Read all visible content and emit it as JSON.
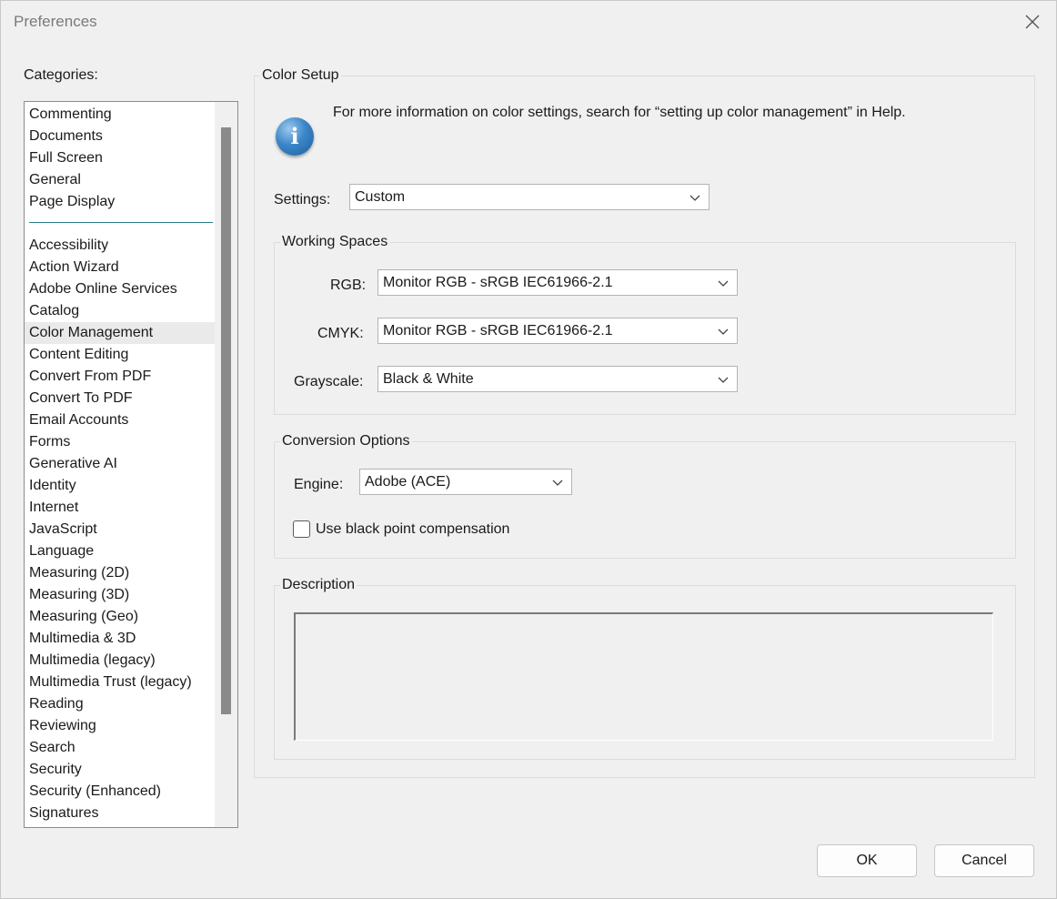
{
  "window": {
    "title": "Preferences",
    "close_icon": "close-icon"
  },
  "categories": {
    "label": "Categories:",
    "top_items": [
      "Commenting",
      "Documents",
      "Full Screen",
      "General",
      "Page Display"
    ],
    "items": [
      "Accessibility",
      "Action Wizard",
      "Adobe Online Services",
      "Catalog",
      "Color Management",
      "Content Editing",
      "Convert From PDF",
      "Convert To PDF",
      "Email Accounts",
      "Forms",
      "Generative AI",
      "Identity",
      "Internet",
      "JavaScript",
      "Language",
      "Measuring (2D)",
      "Measuring (3D)",
      "Measuring (Geo)",
      "Multimedia & 3D",
      "Multimedia (legacy)",
      "Multimedia Trust (legacy)",
      "Reading",
      "Reviewing",
      "Search",
      "Security",
      "Security (Enhanced)",
      "Signatures"
    ],
    "selected": "Color Management"
  },
  "color_setup": {
    "title": "Color Setup",
    "info_text": "For more information on color settings, search for “setting up color management” in Help.",
    "settings_label": "Settings:",
    "settings_value": "Custom"
  },
  "working_spaces": {
    "title": "Working Spaces",
    "rgb_label": "RGB:",
    "rgb_value": "Monitor RGB - sRGB IEC61966-2.1",
    "cmyk_label": "CMYK:",
    "cmyk_value": "Monitor RGB - sRGB IEC61966-2.1",
    "grayscale_label": "Grayscale:",
    "grayscale_value": "Black & White"
  },
  "conversion": {
    "title": "Conversion Options",
    "engine_label": "Engine:",
    "engine_value": "Adobe (ACE)",
    "black_point_label": "Use black point compensation",
    "black_point_checked": false
  },
  "description": {
    "title": "Description",
    "text": ""
  },
  "buttons": {
    "ok": "OK",
    "cancel": "Cancel"
  },
  "colors": {
    "separator": "#2c7a8c",
    "info_icon": "#3b86c9",
    "selected_row": "#eaeaea"
  }
}
